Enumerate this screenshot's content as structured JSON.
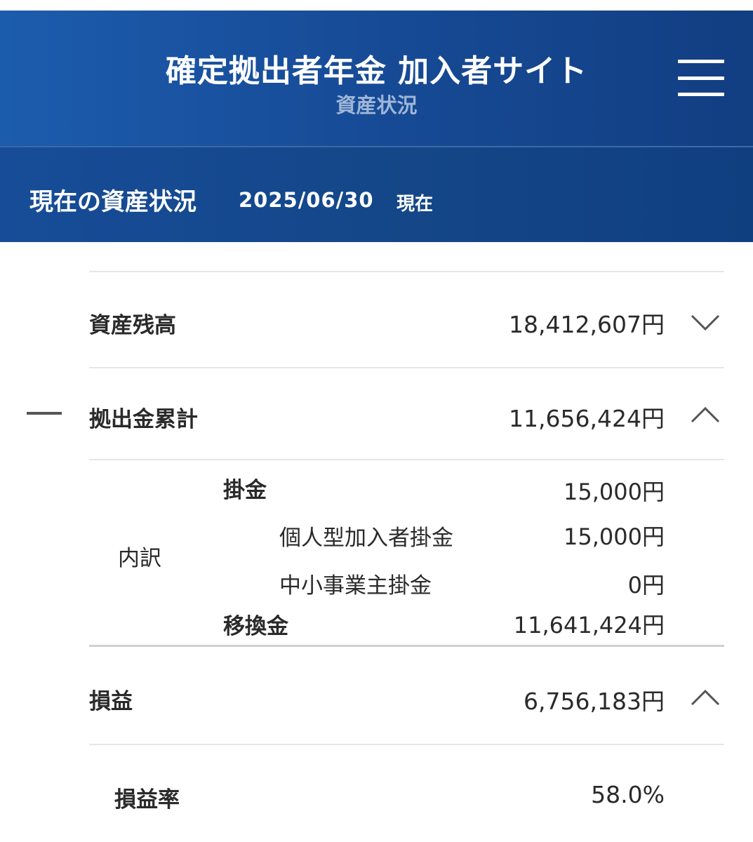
{
  "header": {
    "app_title": "確定拠出者年金 加入者サイト",
    "subtitle": "資産状況",
    "menu_icon": "hamburger-menu-icon"
  },
  "section": {
    "title": "現在の資産状況",
    "date": "2025/06/30",
    "as_of": "現在"
  },
  "summary": {
    "asset_balance": {
      "label": "資産残高",
      "value": "18,412,607円",
      "icon": "chevron-down-icon"
    },
    "contribution_total": {
      "label": "拠出金累計",
      "value": "11,656,424円",
      "icon": "chevron-up-icon"
    },
    "breakdown": {
      "label": "内訳",
      "kakekin": {
        "label": "掛金",
        "value": "15,000円"
      },
      "individual": {
        "label": "個人型加入者掛金",
        "value": "15,000円"
      },
      "sme_owner": {
        "label": "中小事業主掛金",
        "value": "0円"
      },
      "transfer": {
        "label": "移換金",
        "value": "11,641,424円"
      }
    },
    "profit_loss": {
      "label": "損益",
      "value": "6,756,183円",
      "icon": "chevron-up-icon"
    },
    "profit_rate": {
      "label": "損益率",
      "value": "58.0%"
    }
  },
  "colors": {
    "header_bg": "#174c98",
    "subtitle": "#9fb6d8",
    "text": "#2a2a2a"
  }
}
